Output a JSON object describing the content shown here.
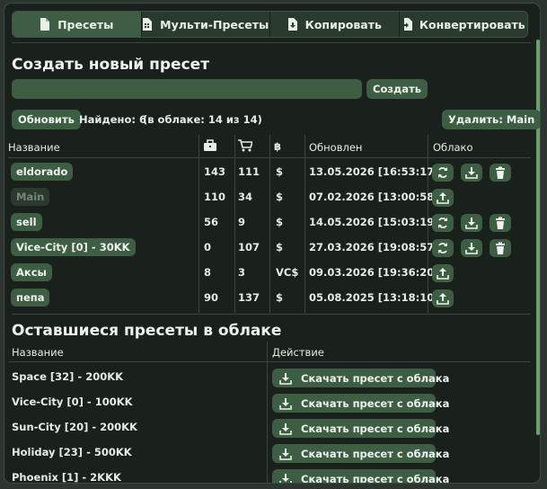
{
  "tabs": [
    {
      "label": "Пресеты",
      "icon": "file-icon",
      "active": true
    },
    {
      "label": "Мульти-Пресеты",
      "icon": "multi-file-icon",
      "active": false
    },
    {
      "label": "Копировать",
      "icon": "file-download-icon",
      "active": false
    },
    {
      "label": "Конвертировать",
      "icon": "file-import-icon",
      "active": false
    }
  ],
  "create": {
    "title": "Создать новый пресет",
    "input_value": "",
    "button": "Создать"
  },
  "toolbar": {
    "refresh": "Обновить",
    "found": "Найдено: 6",
    "cloud_count": "(в облаке: 14 из 14)",
    "delete": "Удалить: Main"
  },
  "table": {
    "headers": {
      "name": "Название",
      "col1": "briefcase-icon",
      "col2": "cart-icon",
      "col3": "฿",
      "updated": "Обновлен",
      "cloud": "Облако"
    },
    "rows": [
      {
        "name": "eldorado",
        "c1": "143",
        "c2": "111",
        "cur": "$",
        "updated": "13.05.2026 [16:53:17]",
        "dim": false,
        "actions": [
          "sync-icon",
          "download-icon",
          "trash-icon"
        ]
      },
      {
        "name": "Main",
        "c1": "110",
        "c2": "34",
        "cur": "$",
        "updated": "07.02.2026 [13:00:58]",
        "dim": true,
        "actions": [
          "upload-icon"
        ]
      },
      {
        "name": "sell",
        "c1": "56",
        "c2": "9",
        "cur": "$",
        "updated": "14.05.2026 [15:03:19]",
        "dim": false,
        "actions": [
          "sync-icon",
          "download-icon",
          "trash-icon"
        ]
      },
      {
        "name": "Vice-City [0] - 30KK",
        "c1": "0",
        "c2": "107",
        "cur": "$",
        "updated": "27.03.2026 [19:08:57]",
        "dim": false,
        "actions": [
          "sync-icon",
          "download-icon",
          "trash-icon"
        ]
      },
      {
        "name": "Аксы",
        "c1": "8",
        "c2": "3",
        "cur": "VC$",
        "updated": "09.03.2026 [19:36:20]",
        "dim": false,
        "actions": [
          "upload-icon"
        ]
      },
      {
        "name": "пепа",
        "c1": "90",
        "c2": "137",
        "cur": "$",
        "updated": "05.08.2025 [13:18:10]",
        "dim": false,
        "actions": [
          "upload-icon"
        ]
      }
    ]
  },
  "cloud": {
    "title": "Оставшиеся пресеты в облаке",
    "headers": {
      "name": "Название",
      "action": "Действие"
    },
    "download_label": "Скачать пресет с облака",
    "rows": [
      "Space [32] - 200KK",
      "Vice-City [0] - 100KK",
      "Sun-City [20] - 200KK",
      "Holiday [23] - 500KK",
      "Phoenix [1] - 2KKK"
    ]
  }
}
